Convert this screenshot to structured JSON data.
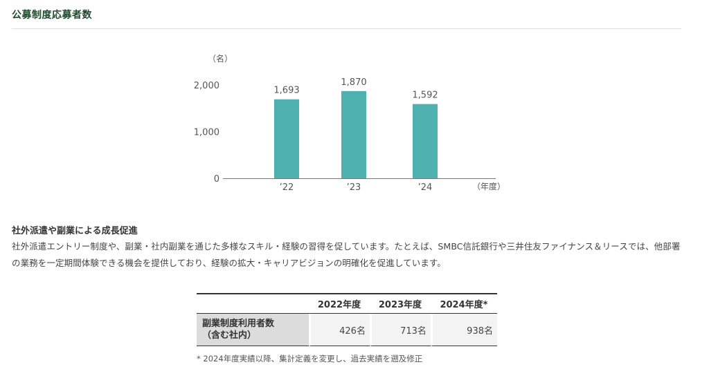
{
  "section": {
    "title": "公募制度応募者数"
  },
  "chart_data": {
    "type": "bar",
    "unit_label": "（名）",
    "categories": [
      "’22",
      "’23",
      "’24"
    ],
    "values": [
      1693,
      1870,
      1592
    ],
    "value_labels": [
      "1,693",
      "1,870",
      "1,592"
    ],
    "x_unit_label": "（年度）",
    "y_ticks": [
      {
        "value": 0,
        "label": "0"
      },
      {
        "value": 1000,
        "label": "1,000"
      },
      {
        "value": 2000,
        "label": "2,000"
      }
    ],
    "ylim": [
      0,
      2000
    ],
    "grid": false,
    "bar_color": "#4fb0b0"
  },
  "subsection": {
    "heading": "社外派遣や副業による成長促進",
    "body": "社外派遣エントリー制度や、副業・社内副業を通じた多様なスキル・経験の習得を促しています。たとえば、SMBC信託銀行や三井住友ファイナンス＆リースでは、他部署の業務を一定期間体験できる機会を提供しており、経験の拡大・キャリアビジョンの明確化を促進しています。"
  },
  "table": {
    "headers": [
      "2022年度",
      "2023年度",
      "2024年度*"
    ],
    "row_label_line1": "副業制度利用者数",
    "row_label_line2": "（含む社内）",
    "values": [
      "426名",
      "713名",
      "938名"
    ]
  },
  "footnote": "* 2024年度実績以降、集計定義を変更し、過去実績を遡及修正"
}
